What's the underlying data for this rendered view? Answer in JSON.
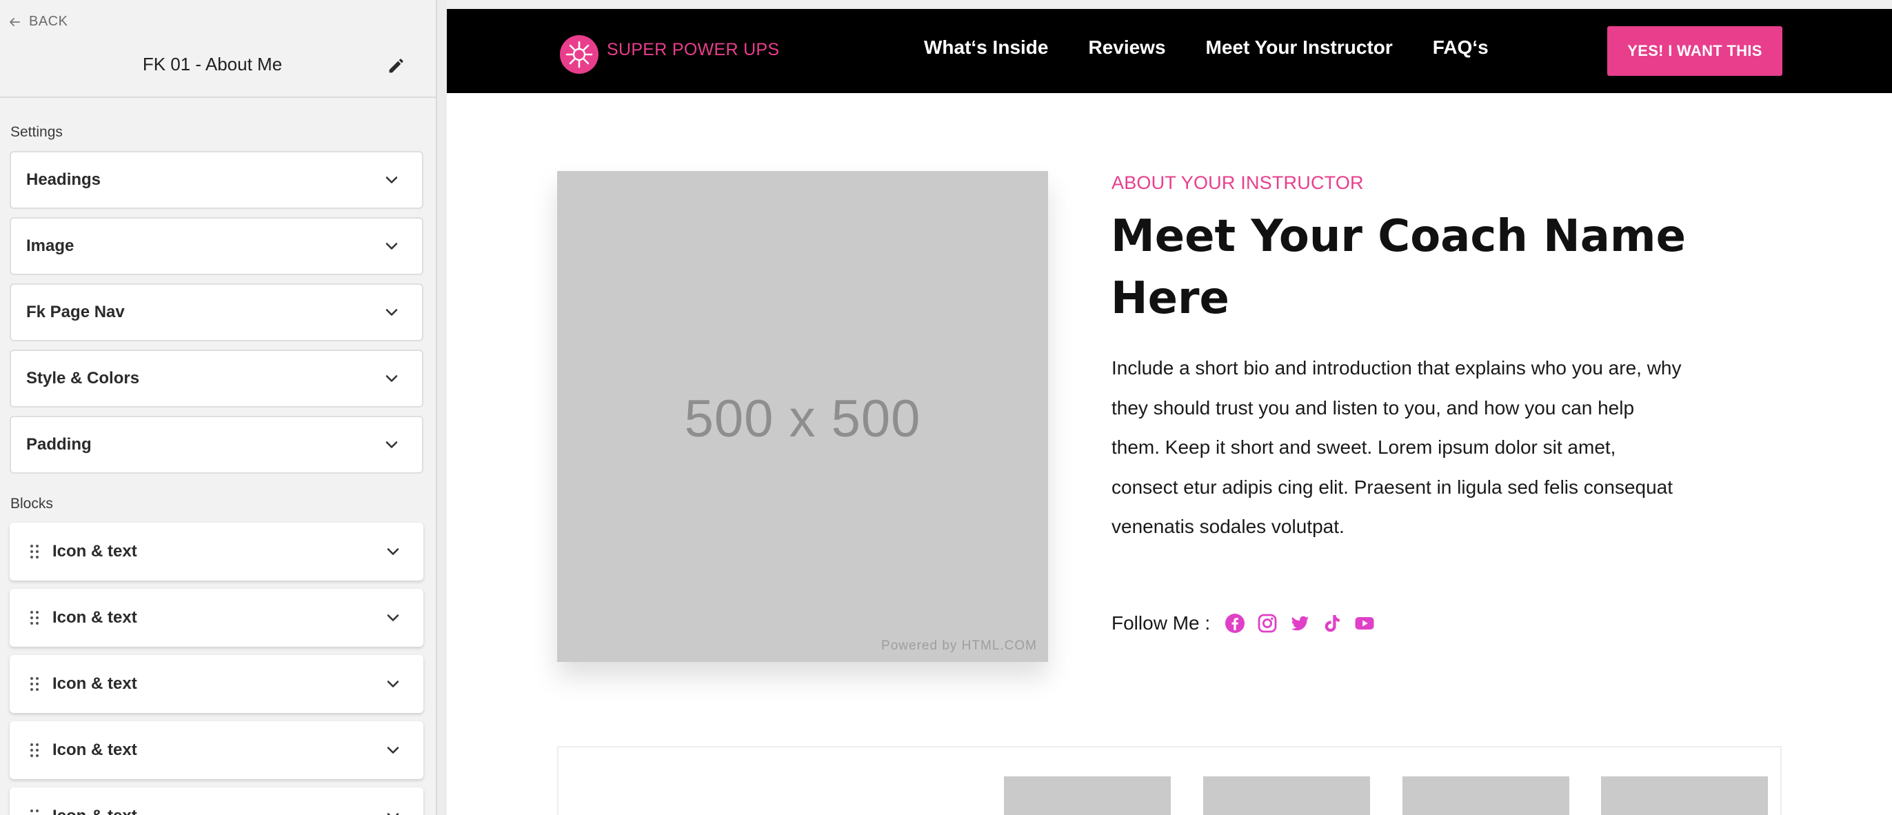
{
  "sidebar": {
    "back_label": "BACK",
    "title": "FK 01 - About Me",
    "settings_label": "Settings",
    "settings": [
      {
        "label": "Headings"
      },
      {
        "label": "Image"
      },
      {
        "label": "Fk Page Nav"
      },
      {
        "label": "Style & Colors"
      },
      {
        "label": "Padding"
      }
    ],
    "blocks_label": "Blocks",
    "blocks": [
      {
        "label": "Icon & text"
      },
      {
        "label": "Icon & text"
      },
      {
        "label": "Icon & text"
      },
      {
        "label": "Icon & text"
      },
      {
        "label": "Icon & text"
      }
    ]
  },
  "nav": {
    "brand": "SUPER POWER UPS",
    "links": [
      {
        "label": "What‘s Inside"
      },
      {
        "label": "Reviews"
      },
      {
        "label": "Meet Your Instructor"
      },
      {
        "label": "FAQ‘s"
      }
    ],
    "cta": "YES! I WANT THIS"
  },
  "about": {
    "placeholder_size": "500 x 500",
    "placeholder_powered": "Powered by HTML.COM",
    "eyebrow": "ABOUT YOUR INSTRUCTOR",
    "heading": "Meet Your Coach Name Here",
    "bio": "Include a short bio and introduction that explains who you are, why they should trust you and listen to you, and how you can help them. Keep it short and sweet. Lorem ipsum dolor sit amet, consect etur adipis cing elit. Praesent in ligula sed felis consequat venenatis sodales volutpat.",
    "follow_label": "Follow Me :",
    "socials": [
      "facebook-icon",
      "instagram-icon",
      "twitter-icon",
      "tiktok-icon",
      "youtube-icon"
    ]
  },
  "colors": {
    "accent_pink": "#e83e8c",
    "social_magenta": "#e040c8",
    "nav_bg": "#000000",
    "placeholder_gray": "#cacaca"
  }
}
